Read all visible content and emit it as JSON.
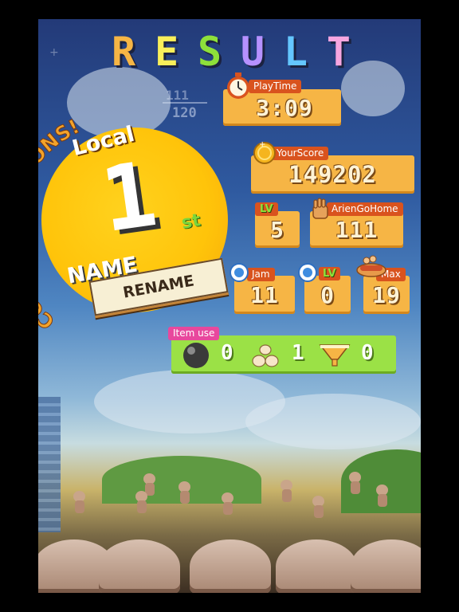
{
  "screen": {
    "title_letters": [
      {
        "char": "R",
        "color": "#f6b545"
      },
      {
        "char": "E",
        "color": "#f9ef5a"
      },
      {
        "char": "S",
        "color": "#8ee03a"
      },
      {
        "char": "U",
        "color": "#b691ff"
      },
      {
        "char": "L",
        "color": "#64c6ff"
      },
      {
        "char": "T",
        "color": "#f7a6e0"
      }
    ],
    "bg_progress": {
      "current": "111",
      "max": "120"
    }
  },
  "ranking": {
    "banner": "CONGRATULATIONS!",
    "scope": "Local",
    "rank": "1",
    "suffix": "st",
    "name_label": "NAME",
    "rename_button": "RENAME"
  },
  "stats": {
    "playtime": {
      "label": "PlayTime",
      "value": "3:09",
      "icon": "stopwatch-icon"
    },
    "score": {
      "label": "YourScore",
      "value": "149202",
      "icon": "coin-icon"
    },
    "level": {
      "label": "LV",
      "value": "5"
    },
    "arien_go_home": {
      "label": "ArienGoHome",
      "value": "111",
      "icon": "hand-icon"
    },
    "jam": {
      "label": "Jam",
      "value": "11",
      "icon": "jam-badge-icon"
    },
    "jam_lv": {
      "label": "LV",
      "value": "0",
      "icon": "jam-badge-icon"
    },
    "max": {
      "label": "Max",
      "value": "19",
      "icon": "hotdog-icon"
    }
  },
  "items": {
    "label": "Item use",
    "entries": [
      {
        "icon": "bomb-icon",
        "count": "0"
      },
      {
        "icon": "dumpling-stack-icon",
        "count": "1"
      },
      {
        "icon": "funnel-icon",
        "count": "0"
      }
    ]
  },
  "colors": {
    "panel": "#f6b545",
    "tag": "#d9531e",
    "item_panel": "#9be146",
    "item_tag": "#e8489d",
    "sun": "#ffc40a"
  }
}
